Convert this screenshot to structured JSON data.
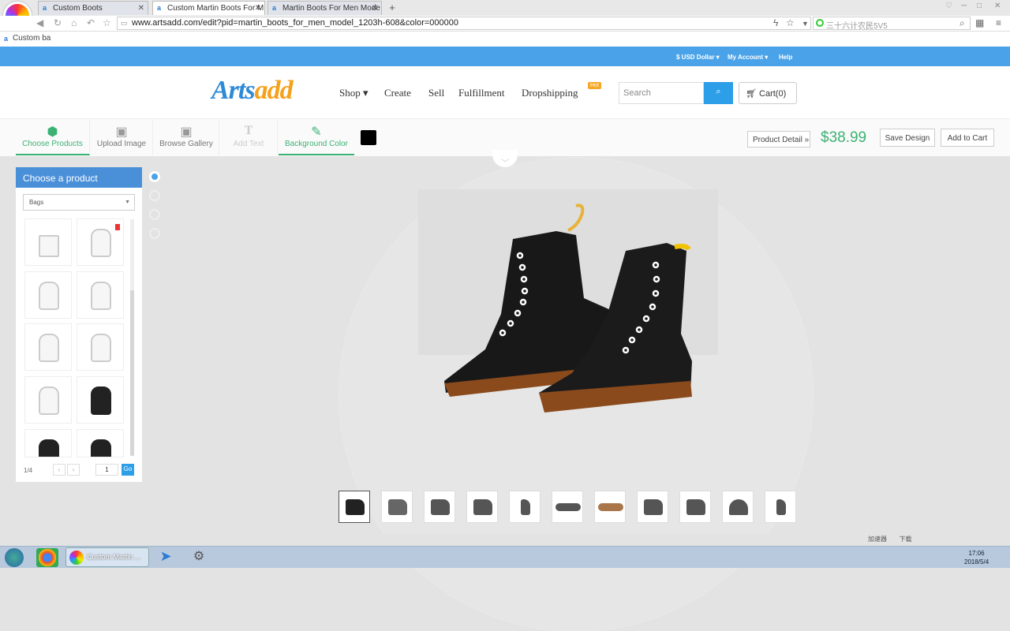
{
  "browser": {
    "tabs": [
      {
        "label": "Custom Boots"
      },
      {
        "label": "Custom Martin Boots For M"
      },
      {
        "label": "Martin Boots For Men Mode"
      }
    ],
    "new_tab": "+",
    "url": "www.artsadd.com/edit?pid=martin_boots_for_men_model_1203h-608&color=000000",
    "search_placeholder": "三十六计农民5V5",
    "bookmark": "Custom ba"
  },
  "topbar": {
    "currency": "$ USD Dollar ▾",
    "account": "My Account ▾",
    "help": "Help"
  },
  "header": {
    "brand_main": "Arts",
    "brand_accent": "add",
    "nav": [
      "Shop ▾",
      "Create",
      "Sell",
      "Fulfillment",
      "Dropshipping"
    ],
    "hot_badge": "Hot",
    "search_placeholder": "Search",
    "cart": "Cart(0)"
  },
  "toolbar": {
    "tools": [
      "Choose Products",
      "Upload Image",
      "Browse Gallery",
      "Add Text",
      "Background Color"
    ],
    "product_detail": "Product Detail »",
    "price": "$38.99",
    "save": "Save Design",
    "add_to_cart": "Add to Cart",
    "selected_color": "#000000"
  },
  "panel": {
    "title": "Choose a product",
    "category": "Bags",
    "page_info": "1/4",
    "page_input": "1",
    "go": "Go",
    "prev": "‹",
    "next": "›"
  },
  "taskbar": {
    "active_window": "Custom Martin ...",
    "download_label": "加速器",
    "download2": "下载",
    "time": "17:06",
    "date": "2018/5/4"
  }
}
